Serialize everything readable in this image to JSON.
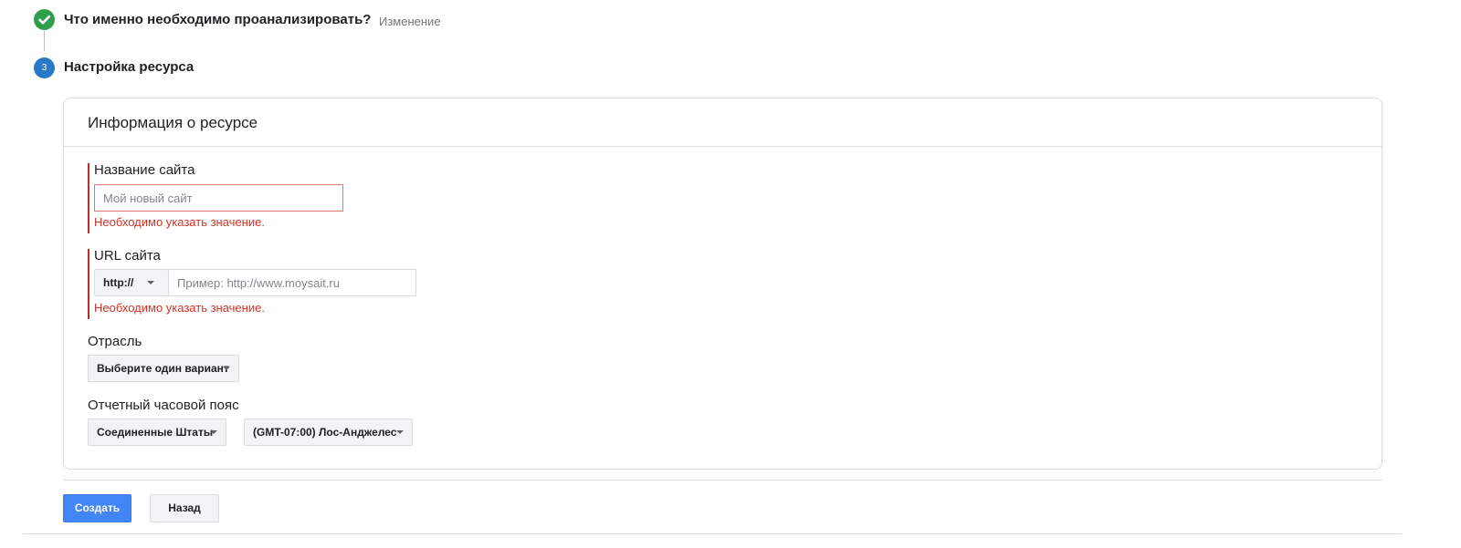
{
  "colors": {
    "step_done": "#2e9e4c",
    "step_active": "#2a78c8",
    "error": "#d93025",
    "primary_button": "#4285f4"
  },
  "stepper": {
    "step1": {
      "title": "Что именно необходимо проанализировать?",
      "edit_label": "Изменение",
      "icon": "checkmark-icon"
    },
    "step3": {
      "number": "3",
      "title": "Настройка ресурса"
    }
  },
  "card": {
    "title": "Информация о ресурсе",
    "site_name": {
      "label": "Название сайта",
      "placeholder": "Мой новый сайт",
      "value": "",
      "error": "Необходимо указать значение."
    },
    "site_url": {
      "label": "URL сайта",
      "protocol": "http://",
      "placeholder": "Пример: http://www.moysait.ru",
      "value": "",
      "error": "Необходимо указать значение."
    },
    "industry": {
      "label": "Отрасль",
      "selected": "Выберите один вариант"
    },
    "timezone": {
      "label": "Отчетный часовой пояс",
      "country": "Соединенные Штаты",
      "zone": "(GMT-07:00) Лос-Анджелес"
    }
  },
  "actions": {
    "create_label": "Создать",
    "back_label": "Назад"
  }
}
